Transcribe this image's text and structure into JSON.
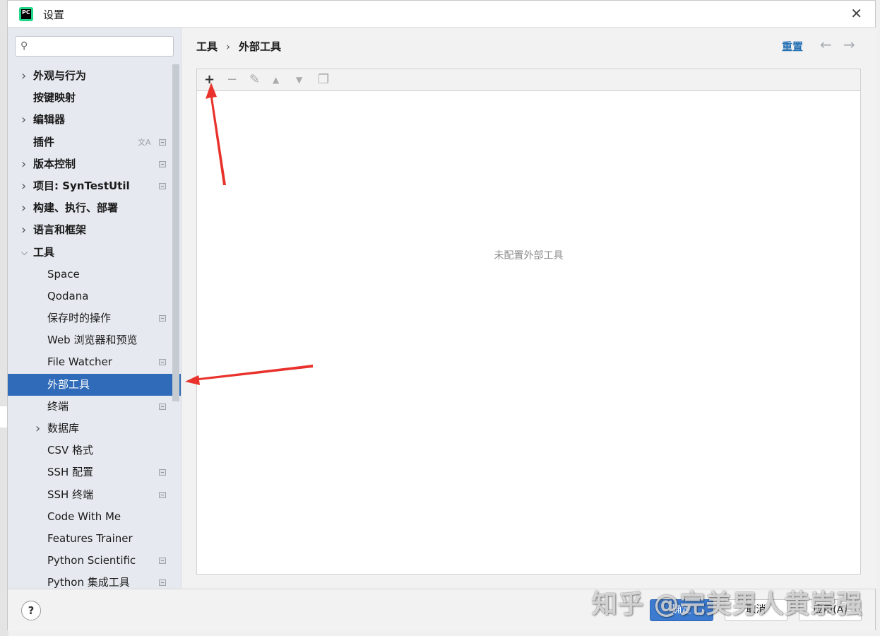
{
  "window": {
    "title": "设置",
    "app_icon": "PC"
  },
  "search": {
    "placeholder": "",
    "value": ""
  },
  "sidebar": {
    "items": [
      {
        "label": "外观与行为",
        "level": 0,
        "chevron": "right"
      },
      {
        "label": "按键映射",
        "level": 0,
        "chevron": "none"
      },
      {
        "label": "编辑器",
        "level": 0,
        "chevron": "right"
      },
      {
        "label": "插件",
        "level": 0,
        "chevron": "none",
        "lang_icon": true,
        "badge": true
      },
      {
        "label": "版本控制",
        "level": 0,
        "chevron": "right",
        "badge": true
      },
      {
        "label": "项目: SynTestUtil",
        "level": 0,
        "chevron": "right",
        "badge": true
      },
      {
        "label": "构建、执行、部署",
        "level": 0,
        "chevron": "right"
      },
      {
        "label": "语言和框架",
        "level": 0,
        "chevron": "right"
      },
      {
        "label": "工具",
        "level": 0,
        "chevron": "down"
      },
      {
        "label": "Space",
        "level": 1,
        "chevron": "none"
      },
      {
        "label": "Qodana",
        "level": 1,
        "chevron": "none"
      },
      {
        "label": "保存时的操作",
        "level": 1,
        "chevron": "none",
        "badge": true
      },
      {
        "label": "Web 浏览器和预览",
        "level": 1,
        "chevron": "none"
      },
      {
        "label": "File Watcher",
        "level": 1,
        "chevron": "none",
        "badge": true
      },
      {
        "label": "外部工具",
        "level": 1,
        "chevron": "none",
        "selected": true
      },
      {
        "label": "终端",
        "level": 1,
        "chevron": "none",
        "badge": true
      },
      {
        "label": "数据库",
        "level": 1,
        "chevron": "right"
      },
      {
        "label": "CSV 格式",
        "level": 1,
        "chevron": "none"
      },
      {
        "label": "SSH 配置",
        "level": 1,
        "chevron": "none",
        "badge": true
      },
      {
        "label": "SSH 终端",
        "level": 1,
        "chevron": "none",
        "badge": true
      },
      {
        "label": "Code With Me",
        "level": 1,
        "chevron": "none"
      },
      {
        "label": "Features Trainer",
        "level": 1,
        "chevron": "none"
      },
      {
        "label": "Python Scientific",
        "level": 1,
        "chevron": "none",
        "badge": true
      },
      {
        "label": "Python 集成工具",
        "level": 1,
        "chevron": "none",
        "badge": true
      }
    ]
  },
  "header": {
    "breadcrumb": [
      "工具",
      "外部工具"
    ],
    "breadcrumb_sep": "›",
    "reset_label": "重置",
    "back_icon": "arrow-left-icon",
    "forward_icon": "arrow-right-icon"
  },
  "toolbar": {
    "buttons": [
      {
        "name": "add-icon",
        "glyph": "+",
        "active": true
      },
      {
        "name": "remove-icon",
        "glyph": "−",
        "active": false
      },
      {
        "name": "edit-icon",
        "glyph": "✎",
        "active": false
      },
      {
        "name": "move-up-icon",
        "glyph": "▲",
        "active": false
      },
      {
        "name": "move-down-icon",
        "glyph": "▼",
        "active": false
      },
      {
        "name": "copy-icon",
        "glyph": "❐",
        "active": false
      }
    ]
  },
  "panel": {
    "empty_text": "未配置外部工具"
  },
  "footer": {
    "help_label": "?",
    "ok_label": "确定",
    "cancel_label": "取消",
    "apply_label": "应用(A)"
  },
  "watermark": "知乎 @完美男人黄崇强",
  "colors": {
    "accent": "#2f6bb8",
    "link": "#2470b3",
    "annotation_arrow": "#e8322b"
  }
}
